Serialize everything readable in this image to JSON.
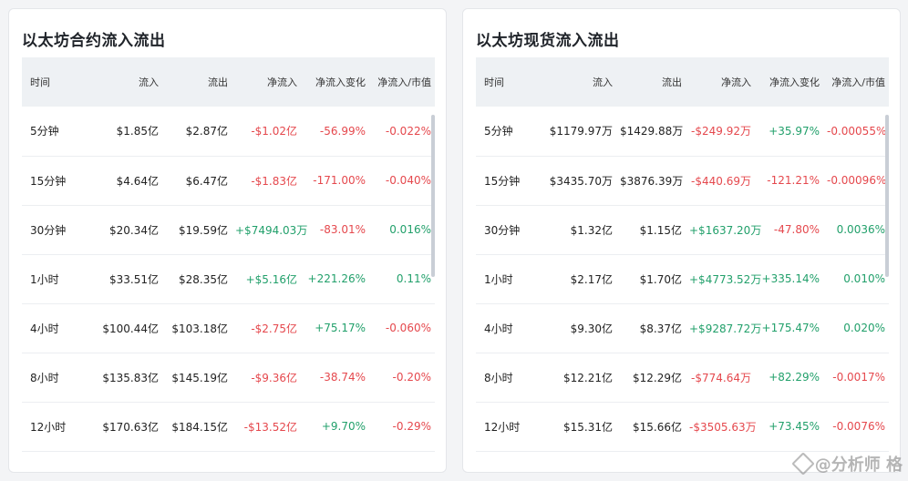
{
  "left": {
    "title": "以太坊合约流入流出",
    "headers": [
      "时间",
      "流入",
      "流出",
      "净流入",
      "净流入变化",
      "净流入/市值"
    ],
    "rows": [
      {
        "time": "5分钟",
        "inflow": "$1.85亿",
        "outflow": "$2.87亿",
        "net": "-$1.02亿",
        "net_color": "red",
        "change": "-56.99%",
        "change_color": "red",
        "ratio": "-0.022%",
        "ratio_color": "red"
      },
      {
        "time": "15分钟",
        "inflow": "$4.64亿",
        "outflow": "$6.47亿",
        "net": "-$1.83亿",
        "net_color": "red",
        "change": "-171.00%",
        "change_color": "red",
        "ratio": "-0.040%",
        "ratio_color": "red"
      },
      {
        "time": "30分钟",
        "inflow": "$20.34亿",
        "outflow": "$19.59亿",
        "net": "+$7494.03万",
        "net_color": "green",
        "change": "-83.01%",
        "change_color": "red",
        "ratio": "0.016%",
        "ratio_color": "green"
      },
      {
        "time": "1小时",
        "inflow": "$33.51亿",
        "outflow": "$28.35亿",
        "net": "+$5.16亿",
        "net_color": "green",
        "change": "+221.26%",
        "change_color": "green",
        "ratio": "0.11%",
        "ratio_color": "green"
      },
      {
        "time": "4小时",
        "inflow": "$100.44亿",
        "outflow": "$103.18亿",
        "net": "-$2.75亿",
        "net_color": "red",
        "change": "+75.17%",
        "change_color": "green",
        "ratio": "-0.060%",
        "ratio_color": "red"
      },
      {
        "time": "8小时",
        "inflow": "$135.83亿",
        "outflow": "$145.19亿",
        "net": "-$9.36亿",
        "net_color": "red",
        "change": "-38.74%",
        "change_color": "red",
        "ratio": "-0.20%",
        "ratio_color": "red"
      },
      {
        "time": "12小时",
        "inflow": "$170.63亿",
        "outflow": "$184.15亿",
        "net": "-$13.52亿",
        "net_color": "red",
        "change": "+9.70%",
        "change_color": "green",
        "ratio": "-0.29%",
        "ratio_color": "red"
      }
    ]
  },
  "right": {
    "title": "以太坊现货流入流出",
    "headers": [
      "时间",
      "流入",
      "流出",
      "净流入",
      "净流入变化",
      "净流入/市值"
    ],
    "rows": [
      {
        "time": "5分钟",
        "inflow": "$1179.97万",
        "outflow": "$1429.88万",
        "net": "-$249.92万",
        "net_color": "red",
        "change": "+35.97%",
        "change_color": "green",
        "ratio": "-0.00055%",
        "ratio_color": "red"
      },
      {
        "time": "15分钟",
        "inflow": "$3435.70万",
        "outflow": "$3876.39万",
        "net": "-$440.69万",
        "net_color": "red",
        "change": "-121.21%",
        "change_color": "red",
        "ratio": "-0.00096%",
        "ratio_color": "red"
      },
      {
        "time": "30分钟",
        "inflow": "$1.32亿",
        "outflow": "$1.15亿",
        "net": "+$1637.20万",
        "net_color": "green",
        "change": "-47.80%",
        "change_color": "red",
        "ratio": "0.0036%",
        "ratio_color": "green"
      },
      {
        "time": "1小时",
        "inflow": "$2.17亿",
        "outflow": "$1.70亿",
        "net": "+$4773.52万",
        "net_color": "green",
        "change": "+335.14%",
        "change_color": "green",
        "ratio": "0.010%",
        "ratio_color": "green"
      },
      {
        "time": "4小时",
        "inflow": "$9.30亿",
        "outflow": "$8.37亿",
        "net": "+$9287.72万",
        "net_color": "green",
        "change": "+175.47%",
        "change_color": "green",
        "ratio": "0.020%",
        "ratio_color": "green"
      },
      {
        "time": "8小时",
        "inflow": "$12.21亿",
        "outflow": "$12.29亿",
        "net": "-$774.64万",
        "net_color": "red",
        "change": "+82.29%",
        "change_color": "green",
        "ratio": "-0.0017%",
        "ratio_color": "red"
      },
      {
        "time": "12小时",
        "inflow": "$15.31亿",
        "outflow": "$15.66亿",
        "net": "-$3505.63万",
        "net_color": "red",
        "change": "+73.45%",
        "change_color": "green",
        "ratio": "-0.0076%",
        "ratio_color": "red"
      }
    ]
  },
  "watermark": {
    "text": "@分析师 格",
    "icon": "logo-icon"
  }
}
